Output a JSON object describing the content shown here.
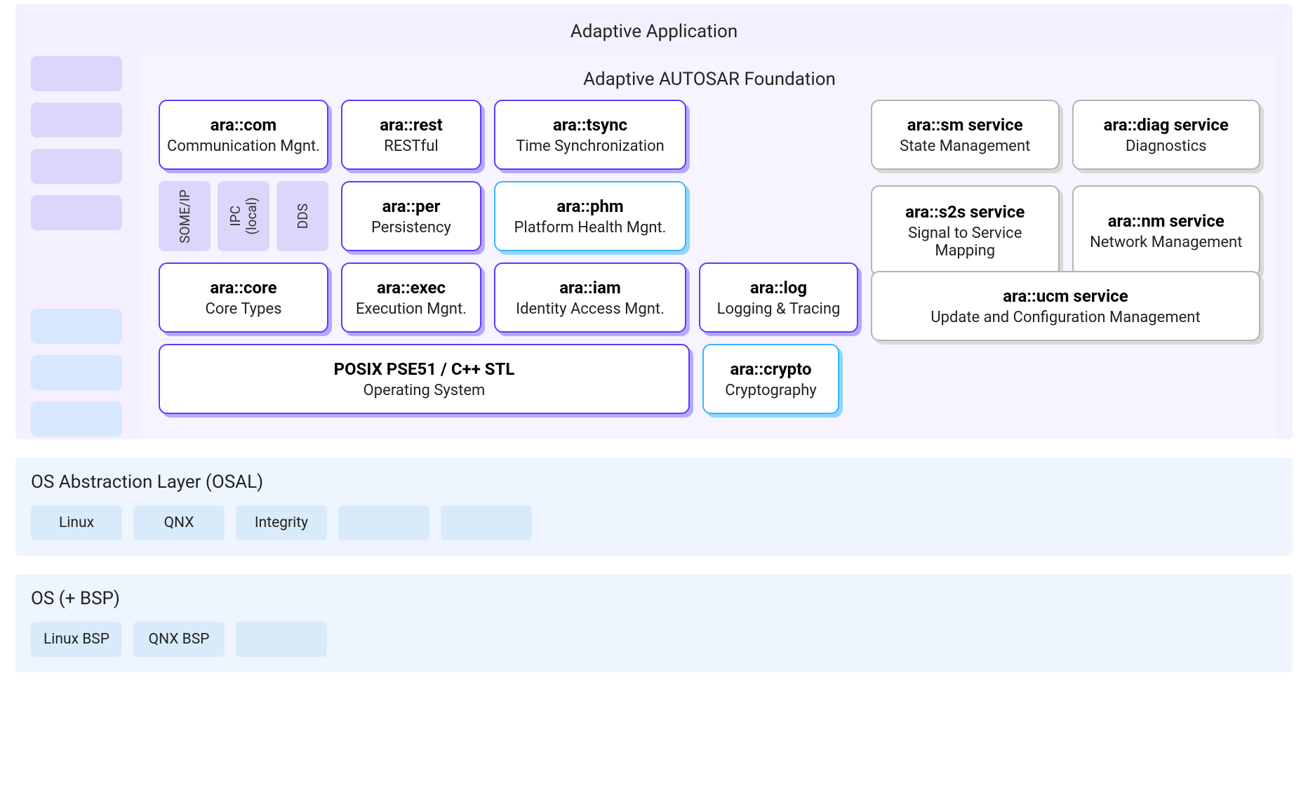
{
  "app_title": "Adaptive Application",
  "foundation_title": "Adaptive AUTOSAR Foundation",
  "modules": {
    "com": {
      "name": "ara::com",
      "sub": "Communication Mgnt."
    },
    "rest": {
      "name": "ara::rest",
      "sub": "RESTful"
    },
    "tsync": {
      "name": "ara::tsync",
      "sub": "Time Synchronization"
    },
    "per": {
      "name": "ara::per",
      "sub": "Persistency"
    },
    "phm": {
      "name": "ara::phm",
      "sub": "Platform Health Mgnt."
    },
    "core": {
      "name": "ara::core",
      "sub": "Core Types"
    },
    "exec": {
      "name": "ara::exec",
      "sub": "Execution Mgnt."
    },
    "iam": {
      "name": "ara::iam",
      "sub": "Identity Access Mgnt."
    },
    "log": {
      "name": "ara::log",
      "sub": "Logging & Tracing"
    },
    "posix": {
      "name": "POSIX PSE51 / C++ STL",
      "sub": "Operating System"
    },
    "crypto": {
      "name": "ara::crypto",
      "sub": "Cryptography"
    }
  },
  "protocols": {
    "someip": "SOME/IP",
    "ipc_a": "IPC",
    "ipc_b": "(local)",
    "dds": "DDS"
  },
  "services": {
    "sm": {
      "name": "ara::sm service",
      "sub": "State Management"
    },
    "diag": {
      "name": "ara::diag service",
      "sub": "Diagnostics"
    },
    "s2s": {
      "name": "ara::s2s service",
      "sub": "Signal to Service Mapping"
    },
    "nm": {
      "name": "ara::nm service",
      "sub": "Network Management"
    },
    "ucm": {
      "name": "ara::ucm service",
      "sub": "Update and Configuration Management"
    }
  },
  "osal": {
    "title": "OS Abstraction Layer (OSAL)",
    "items": [
      "Linux",
      "QNX",
      "Integrity",
      "",
      ""
    ]
  },
  "osbsp": {
    "title": "OS (+ BSP)",
    "items": [
      "Linux BSP",
      "QNX BSP",
      ""
    ]
  }
}
